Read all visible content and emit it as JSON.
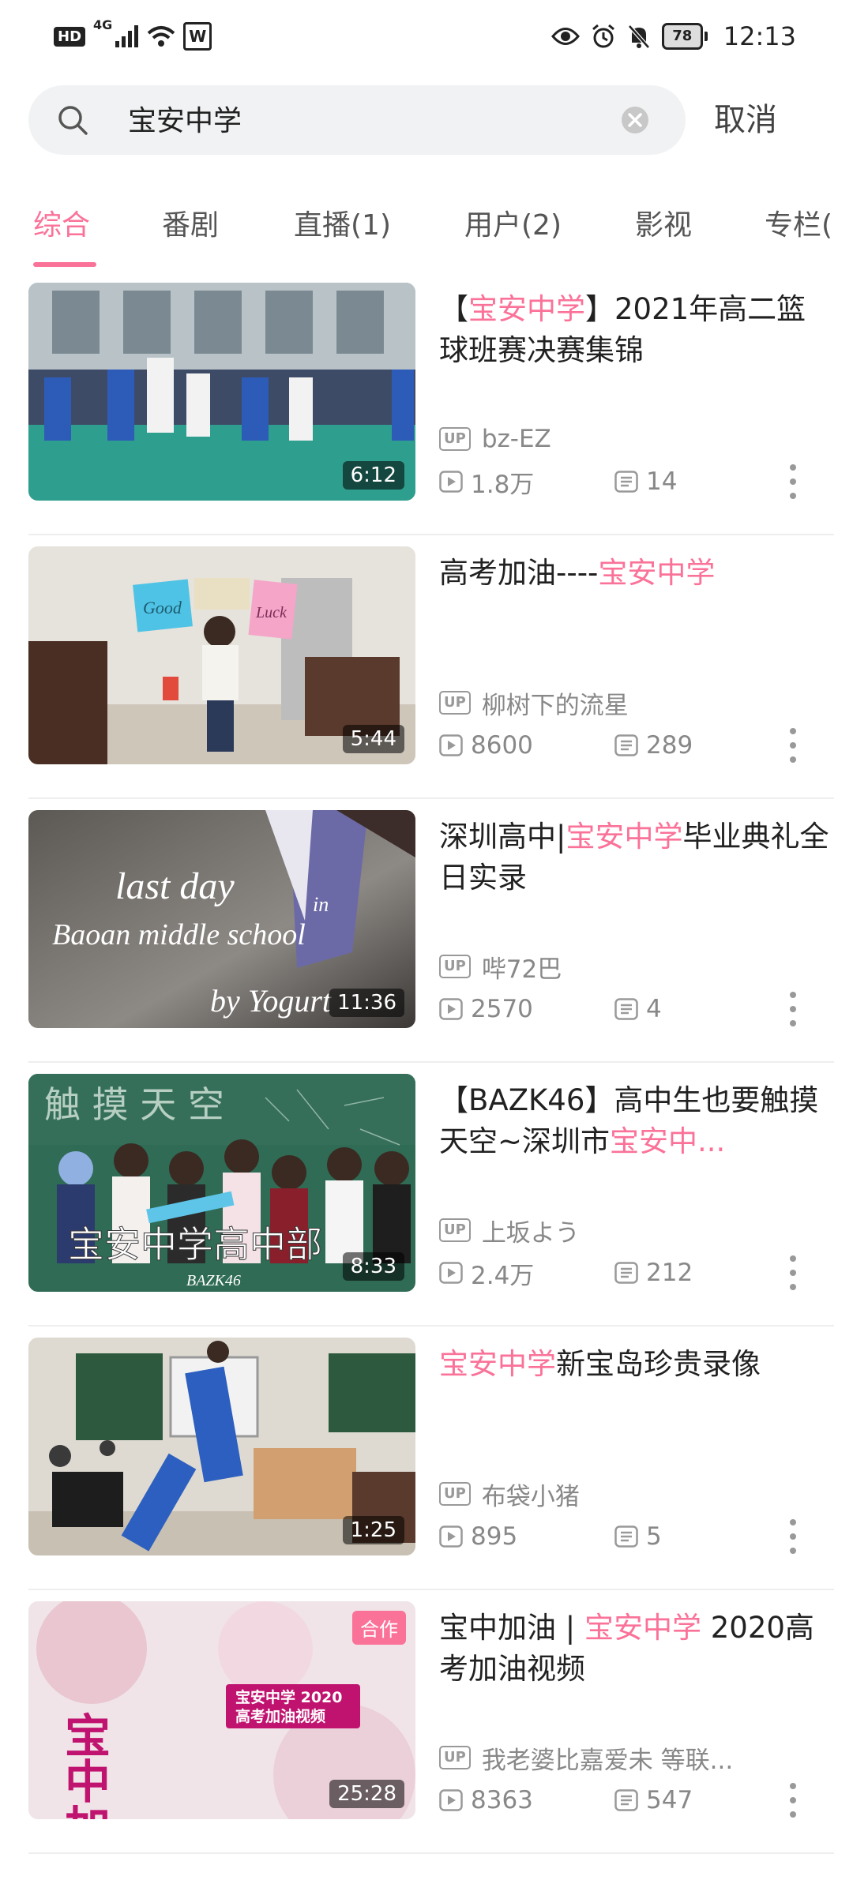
{
  "status_bar": {
    "left_badges": [
      "HD",
      "4G",
      "W"
    ],
    "battery": "78",
    "time": "12:13"
  },
  "search": {
    "query": "宝安中学",
    "cancel_label": "取消"
  },
  "tabs": [
    "综合",
    "番剧",
    "直播(1)",
    "用户(2)",
    "影视",
    "专栏("
  ],
  "active_tab": 0,
  "accent_color": "#fb7299",
  "results": [
    {
      "title_parts": [
        "【",
        "宝安中学",
        "】2021年高二篮球班赛决赛集锦"
      ],
      "highlight_index": 1,
      "duration": "6:12",
      "up_badge": "UP",
      "uploader": "bz-EZ",
      "plays": "1.8万",
      "comments": "14"
    },
    {
      "title_parts": [
        "高考加油----",
        "宝安中学",
        ""
      ],
      "highlight_index": 1,
      "duration": "5:44",
      "up_badge": "UP",
      "uploader": "柳树下的流星",
      "plays": "8600",
      "comments": "289"
    },
    {
      "title_parts": [
        "深圳高中|",
        "宝安中学",
        "毕业典礼全日实录"
      ],
      "highlight_index": 1,
      "duration": "11:36",
      "up_badge": "UP",
      "uploader": "哔72巴",
      "plays": "2570",
      "comments": "4"
    },
    {
      "title_parts": [
        "【BAZK46】高中生也要触摸天空~深圳市",
        "宝安中...",
        ""
      ],
      "highlight_index": 1,
      "duration": "8:33",
      "up_badge": "UP",
      "uploader": "上坂よう",
      "plays": "2.4万",
      "comments": "212"
    },
    {
      "title_parts": [
        "",
        "宝安中学",
        "新宝岛珍贵录像"
      ],
      "highlight_index": 1,
      "duration": "1:25",
      "up_badge": "UP",
      "uploader": "布袋小猪",
      "plays": "895",
      "comments": "5"
    },
    {
      "title_parts": [
        "宝中加油 | ",
        "宝安中学",
        " 2020高考加油视频"
      ],
      "highlight_index": 1,
      "duration": "25:28",
      "badge": "合作",
      "up_badge": "UP",
      "uploader": "我老婆比嘉爱未 等联...",
      "plays": "8363",
      "comments": "547"
    }
  ],
  "thumbnail_text": {
    "r2_left": "Good",
    "r2_right": "Luck",
    "r3_line1": "last day",
    "r3_line1_small": "in",
    "r3_line2": "Baoan middle school",
    "r3_line3": "by Yogurt",
    "r4_top": "触 摸 天 空",
    "r4_main": "宝安中学高中部",
    "r4_sub": "BAZK46",
    "r6_big": "宝中加油",
    "r6_box1": "宝安中学 2020",
    "r6_box2": "高考加油视频"
  }
}
